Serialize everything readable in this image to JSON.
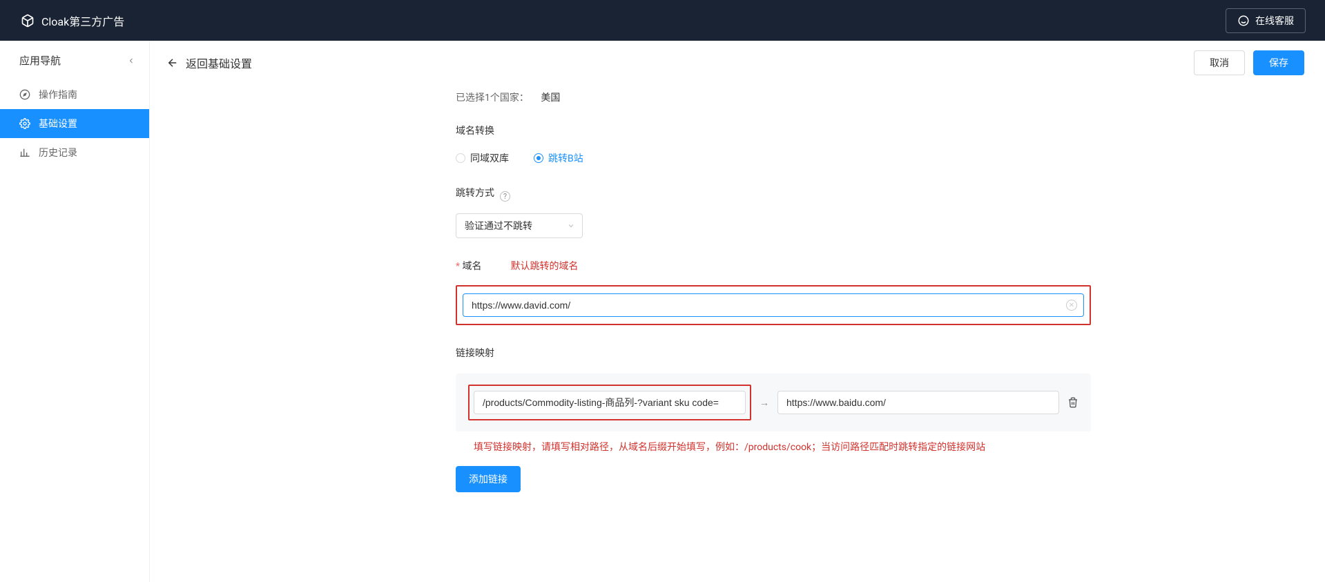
{
  "brand": "Cloak第三方广告",
  "cs_label": "在线客服",
  "sidebar": {
    "title": "应用导航",
    "items": [
      {
        "label": "操作指南"
      },
      {
        "label": "基础设置"
      },
      {
        "label": "历史记录"
      }
    ]
  },
  "page": {
    "back_label": "返回基础设置",
    "cancel": "取消",
    "save": "保存"
  },
  "form": {
    "selected_country_label": "已选择1个国家：",
    "selected_country_value": "美国",
    "domain_convert_label": "域名转换",
    "radio_same": "同域双库",
    "radio_jump": "跳转B站",
    "jump_mode_label": "跳转方式",
    "jump_mode_value": "验证通过不跳转",
    "domain_label": "域名",
    "domain_anno": "默认跳转的域名",
    "domain_value": "https://www.david.com/",
    "mapping_label": "链接映射",
    "map_src": "/products/Commodity-listing-商品列-?variant sku code=",
    "map_dst": "https://www.baidu.com/",
    "mapping_anno": "填写链接映射，请填写相对路径，从域名后缀开始填写，例如：/products/cook；当访问路径匹配时跳转指定的链接网站",
    "add_link": "添加链接"
  }
}
